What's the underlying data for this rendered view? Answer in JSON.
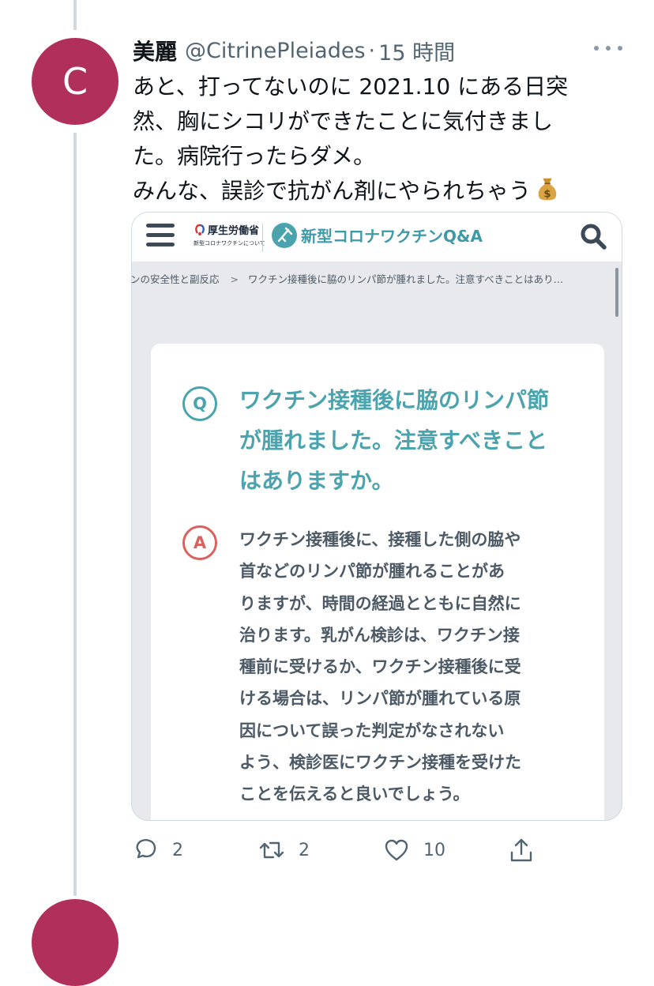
{
  "tweet": {
    "avatar_letter": "C",
    "display_name": "美麗",
    "handle": "@CitrinePleiades",
    "separator": "·",
    "time": "15 時間",
    "text_lines": [
      "あと、打ってないのに 2021.10 にある日突",
      "然、胸にシコリができたことに気付きまし",
      "た。病院行ったらダメ。",
      "みんな、誤診で抗がん剤にやられちゃう"
    ],
    "emoji": "money-bag",
    "accent_color": "#b0305b"
  },
  "card": {
    "header": {
      "ministry_name": "厚生労働省",
      "ministry_sub": "新型コロナワクチンについて",
      "site_title": "新型コロナワクチンQ&A"
    },
    "breadcrumb": {
      "previous": "ンの安全性と副反応",
      "separator": ">",
      "current": "ワクチン接種後に脇のリンパ節が腫れました。注意すべきことはあり…"
    },
    "q_label": "Q",
    "a_label": "A",
    "question_lines": [
      "ワクチン接種後に脇のリンパ節",
      "が腫れました。注意すべきこと",
      "はありますか。"
    ],
    "answer_lines": [
      "ワクチン接種後に、接種した側の脇や",
      "首などのリンパ節が腫れることがあ",
      "りますが、時間の経過とともに自然に",
      "治ります。乳がん検診は、ワクチン接",
      "種前に受けるか、ワクチン接種後に受",
      "ける場合は、リンパ節が腫れている原",
      "因について誤った判定がなされない",
      "よう、検診医にワクチン接種を受けた",
      "ことを伝えると良いでしょう。"
    ],
    "colors": {
      "question": "#4aa3ad",
      "answer_badge": "#d9625f",
      "answer_text": "#4d5a66"
    }
  },
  "actions": {
    "reply_count": "2",
    "retweet_count": "2",
    "like_count": "10"
  }
}
